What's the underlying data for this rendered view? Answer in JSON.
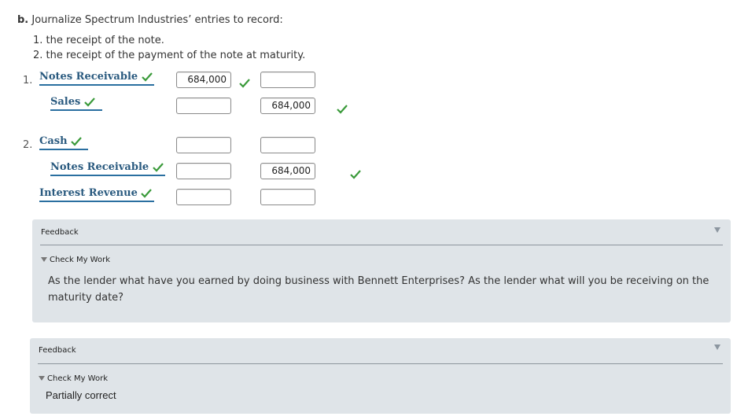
{
  "question": {
    "part_letter": "b.",
    "prompt": "Journalize Spectrum Industries’ entries to record:",
    "items": [
      "1. the receipt of the note.",
      "2. the receipt of the payment of the note at maturity."
    ]
  },
  "entries": [
    {
      "number": "1.",
      "lines": [
        {
          "account": "Notes Receivable",
          "debit": "684,000",
          "credit": ""
        },
        {
          "account": "Sales",
          "debit": "",
          "credit": "684,000"
        }
      ]
    },
    {
      "number": "2.",
      "lines": [
        {
          "account": "Cash",
          "debit": "",
          "credit": ""
        },
        {
          "account": "Notes Receivable",
          "debit": "",
          "credit": "684,000"
        },
        {
          "account": "Interest Revenue",
          "debit": "",
          "credit": ""
        }
      ]
    }
  ],
  "feedback_panels": [
    {
      "heading": "Feedback",
      "toggle_label": "Check My Work",
      "message": "As the lender what have you earned by doing business with Bennett Enterprises? As the lender what will you be receiving on the maturity date?"
    },
    {
      "heading": "Feedback",
      "toggle_label": "Check My Work",
      "message": "Partially correct"
    }
  ],
  "colors": {
    "check_green": "#3a9a3a",
    "account_blue": "#2a5a7f",
    "panel_bg": "#dfe4e8"
  },
  "icons": {
    "check": "checkmark-icon",
    "collapse": "triangle-down-icon"
  }
}
